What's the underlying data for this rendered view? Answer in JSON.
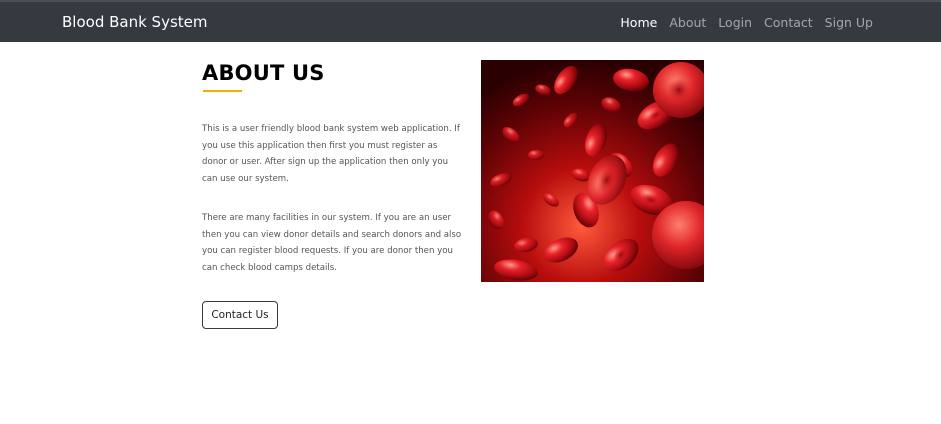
{
  "navbar": {
    "brand": "Blood Bank System",
    "links": [
      {
        "label": "Home",
        "active": true
      },
      {
        "label": "About",
        "active": false
      },
      {
        "label": "Login",
        "active": false
      },
      {
        "label": "Contact",
        "active": false
      },
      {
        "label": "Sign Up",
        "active": false
      }
    ]
  },
  "about": {
    "title": "ABOUT US",
    "paragraph1": "This is a user friendly blood bank system web application. If you use this application then first you must register as donor or user. After sign up the application then only you can use our system.",
    "paragraph2": "There are many facilities in our system. If you are an user then you can view donor details and search donors and also you can register blood requests. If you are donor then you can check blood camps details.",
    "button_label": "Contact Us"
  },
  "colors": {
    "navbar_bg": "#343a40",
    "accent_underline": "#f1b000",
    "blood_red": "#c8141a"
  },
  "image": {
    "icon": "red-blood-cells-image"
  }
}
